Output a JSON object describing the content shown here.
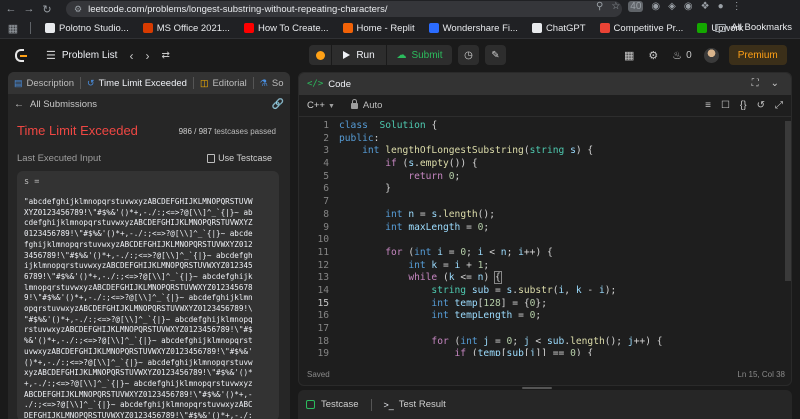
{
  "browser": {
    "url": "leetcode.com/problems/longest-substring-without-repeating-characters/",
    "badge": "40",
    "bookmarks": [
      {
        "label": "Polotno Studio...",
        "color": "#e8eaed"
      },
      {
        "label": "MS Office 2021...",
        "color": "#d83b01"
      },
      {
        "label": "How To Create...",
        "color": "#ff0000"
      },
      {
        "label": "Home - Replit",
        "color": "#f26207"
      },
      {
        "label": "Wondershare Fi...",
        "color": "#2b6cff"
      },
      {
        "label": "ChatGPT",
        "color": "#e8eaed"
      },
      {
        "label": "Competitive Pr...",
        "color": "#ea4335"
      },
      {
        "label": "Upwork",
        "color": "#14a800"
      }
    ],
    "all_bookmarks": "All Bookmarks"
  },
  "header": {
    "problem_list": "Problem List",
    "run": "Run",
    "submit": "Submit",
    "streak": "0",
    "premium": "Premium"
  },
  "left": {
    "tabs": [
      {
        "label": "Description",
        "icon": "▤"
      },
      {
        "label": "Time Limit Exceeded",
        "icon": "↺"
      },
      {
        "label": "Editorial",
        "icon": "◫"
      },
      {
        "label": "So",
        "icon": "⚗"
      }
    ],
    "all_submissions": "All Submissions",
    "verdict": "Time Limit Exceeded",
    "passed_count": "986 / 987",
    "passed_label": "testcases passed",
    "last_input_label": "Last Executed Input",
    "use_testcase": "Use Testcase",
    "var_name": "s =",
    "input_lines": [
      "\"abcdefghijklmnopqrstuvwxyzABCDEFGHIJKLMNOPQRSTUVW",
      "XYZ0123456789!\\\"#$%&'()*+,-./:;<=>?@[\\\\]^_`{|}~ ab",
      "cdefghijklmnopqrstuvwxyzABCDEFGHIJKLMNOPQRSTUVWXYZ",
      "0123456789!\\\"#$%&'()*+,-./:;<=>?@[\\\\]^_`{|}~ abcde",
      "fghijklmnopqrstuvwxyzABCDEFGHIJKLMNOPQRSTUVWXYZ012",
      "3456789!\\\"#$%&'()*+,-./:;<=>?@[\\\\]^_`{|}~ abcdefgh",
      "ijklmnopqrstuvwxyzABCDEFGHIJKLMNOPQRSTUVWXYZ012345",
      "6789!\\\"#$%&'()*+,-./:;<=>?@[\\\\]^_`{|}~ abcdefghijk",
      "lmnopqrstuvwxyzABCDEFGHIJKLMNOPQRSTUVWXYZ012345678",
      "9!\\\"#$%&'()*+,-./:;<=>?@[\\\\]^_`{|}~ abcdefghijklmn",
      "opqrstuvwxyzABCDEFGHIJKLMNOPQRSTUVWXYZ0123456789!\\",
      "\"#$%&'()*+,-./:;<=>?@[\\\\]^_`{|}~ abcdefghijklmnopq",
      "rstuvwxyzABCDEFGHIJKLMNOPQRSTUVWXYZ0123456789!\\\"#$",
      "%&'()*+,-./:;<=>?@[\\\\]^_`{|}~ abcdefghijklmnopqrst",
      "uvwxyzABCDEFGHIJKLMNOPQRSTUVWXYZ0123456789!\\\"#$%&'",
      "()*+,-./:;<=>?@[\\\\]^_`{|}~ abcdefghijklmnopqrstuvw",
      "xyzABCDEFGHIJKLMNOPQRSTUVWXYZ0123456789!\\\"#$%&'()*",
      "+,-./:;<=>?@[\\\\]^_`{|}~ abcdefghijklmnopqrstuvwxyz",
      "ABCDEFGHIJKLMNOPQRSTUVWXYZ0123456789!\\\"#$%&'()*+,-",
      "./:;<=>?@[\\\\]^_`{|}~ abcdefghijklmnopqrstuvwxyzABC",
      "DEFGHIJKLMNOPQRSTUVWXYZ0123456789!\\\"#$%&'()*+,-./:"
    ]
  },
  "editor": {
    "tab_label": "Code",
    "language": "C++",
    "mode": "Auto",
    "current_line": 15,
    "status_saved": "Saved",
    "status_pos": "Ln 15, Col 38",
    "lines": [
      [
        [
          "kw",
          "class"
        ],
        [
          "",
          "  "
        ],
        [
          "ty",
          "Solution"
        ],
        [
          "",
          " {"
        ]
      ],
      [
        [
          "kw",
          "public"
        ],
        [
          "",
          ":"
        ]
      ],
      [
        [
          "",
          "    "
        ],
        [
          "kw",
          "int"
        ],
        [
          "",
          ""
        ],
        [
          "",
          ""
        ],
        [
          "fn",
          " lengthOfLongestSubstring"
        ],
        [
          "",
          "("
        ],
        [
          "ty",
          "string"
        ],
        [
          "",
          " "
        ],
        [
          "vr",
          "s"
        ],
        [
          "",
          ") {"
        ]
      ],
      [
        [
          "",
          "        "
        ],
        [
          "ctl",
          "if"
        ],
        [
          "",
          " ("
        ],
        [
          "vr",
          "s"
        ],
        [
          "",
          "."
        ],
        [
          "fn",
          "empty"
        ],
        [
          "",
          "()) {"
        ]
      ],
      [
        [
          "",
          "            "
        ],
        [
          "ctl",
          "return"
        ],
        [
          "",
          " "
        ],
        [
          "nm",
          "0"
        ],
        [
          "",
          ";"
        ]
      ],
      [
        [
          "",
          "        }"
        ]
      ],
      [
        [
          "",
          ""
        ]
      ],
      [
        [
          "",
          "        "
        ],
        [
          "kw",
          "int"
        ],
        [
          "",
          " "
        ],
        [
          "vr",
          "n"
        ],
        [
          "",
          " = "
        ],
        [
          "vr",
          "s"
        ],
        [
          "",
          "."
        ],
        [
          "fn",
          "length"
        ],
        [
          "",
          "();"
        ]
      ],
      [
        [
          "",
          "        "
        ],
        [
          "kw",
          "int"
        ],
        [
          "",
          " "
        ],
        [
          "vr",
          "maxLength"
        ],
        [
          "",
          " = "
        ],
        [
          "nm",
          "0"
        ],
        [
          "",
          ";"
        ]
      ],
      [
        [
          "",
          ""
        ]
      ],
      [
        [
          "",
          "        "
        ],
        [
          "ctl",
          "for"
        ],
        [
          "",
          " ("
        ],
        [
          "kw",
          "int"
        ],
        [
          "",
          " "
        ],
        [
          "vr",
          "i"
        ],
        [
          "",
          " = "
        ],
        [
          "nm",
          "0"
        ],
        [
          "",
          "; "
        ],
        [
          "vr",
          "i"
        ],
        [
          "",
          " < "
        ],
        [
          "vr",
          "n"
        ],
        [
          "",
          "; "
        ],
        [
          "vr",
          "i"
        ],
        [
          "",
          "++) {"
        ]
      ],
      [
        [
          "",
          "            "
        ],
        [
          "kw",
          "int"
        ],
        [
          "",
          " "
        ],
        [
          "vr",
          "k"
        ],
        [
          "",
          " = "
        ],
        [
          "vr",
          "i"
        ],
        [
          "",
          " + "
        ],
        [
          "nm",
          "1"
        ],
        [
          "",
          ";"
        ]
      ],
      [
        [
          "",
          "            "
        ],
        [
          "ctl",
          "while"
        ],
        [
          "",
          " ("
        ],
        [
          "vr",
          "k"
        ],
        [
          "",
          " <= "
        ],
        [
          "vr",
          "n"
        ],
        [
          "",
          ") "
        ],
        [
          "bracket",
          "{"
        ]
      ],
      [
        [
          "",
          "                "
        ],
        [
          "ty",
          "string"
        ],
        [
          "",
          " "
        ],
        [
          "vr",
          "sub"
        ],
        [
          "",
          " = "
        ],
        [
          "vr",
          "s"
        ],
        [
          "",
          "."
        ],
        [
          "fn",
          "substr"
        ],
        [
          "",
          "("
        ],
        [
          "vr",
          "i"
        ],
        [
          "",
          ", "
        ],
        [
          "vr",
          "k"
        ],
        [
          "",
          " - "
        ],
        [
          "vr",
          "i"
        ],
        [
          "",
          ");"
        ]
      ],
      [
        [
          "",
          "                "
        ],
        [
          "kw",
          "int"
        ],
        [
          "",
          " "
        ],
        [
          "vr",
          "temp"
        ],
        [
          "",
          "["
        ],
        [
          "nm",
          "128"
        ],
        [
          "",
          "] = {"
        ],
        [
          "nm",
          "0"
        ],
        [
          "",
          "};"
        ]
      ],
      [
        [
          "",
          "                "
        ],
        [
          "kw",
          "int"
        ],
        [
          "",
          " "
        ],
        [
          "vr",
          "tempLength"
        ],
        [
          "",
          " = "
        ],
        [
          "nm",
          "0"
        ],
        [
          "",
          ";"
        ]
      ],
      [
        [
          "",
          ""
        ]
      ],
      [
        [
          "",
          "                "
        ],
        [
          "ctl",
          "for"
        ],
        [
          "",
          " ("
        ],
        [
          "kw",
          "int"
        ],
        [
          "",
          " "
        ],
        [
          "vr",
          "j"
        ],
        [
          "",
          " = "
        ],
        [
          "nm",
          "0"
        ],
        [
          "",
          "; "
        ],
        [
          "vr",
          "j"
        ],
        [
          "",
          " < "
        ],
        [
          "vr",
          "sub"
        ],
        [
          "",
          "."
        ],
        [
          "fn",
          "length"
        ],
        [
          "",
          "(); "
        ],
        [
          "vr",
          "j"
        ],
        [
          "",
          "++) {"
        ]
      ],
      [
        [
          "",
          "                    "
        ],
        [
          "ctl",
          "if"
        ],
        [
          "",
          " ("
        ],
        [
          "vr",
          "temp"
        ],
        [
          "",
          "["
        ],
        [
          "vr",
          "sub"
        ],
        [
          "",
          "["
        ],
        [
          "vr",
          "j"
        ],
        [
          "",
          "]] == "
        ],
        [
          "nm",
          "0"
        ],
        [
          "",
          ") {"
        ]
      ]
    ]
  },
  "bottom": {
    "testcase": "Testcase",
    "test_result": "Test Result"
  }
}
